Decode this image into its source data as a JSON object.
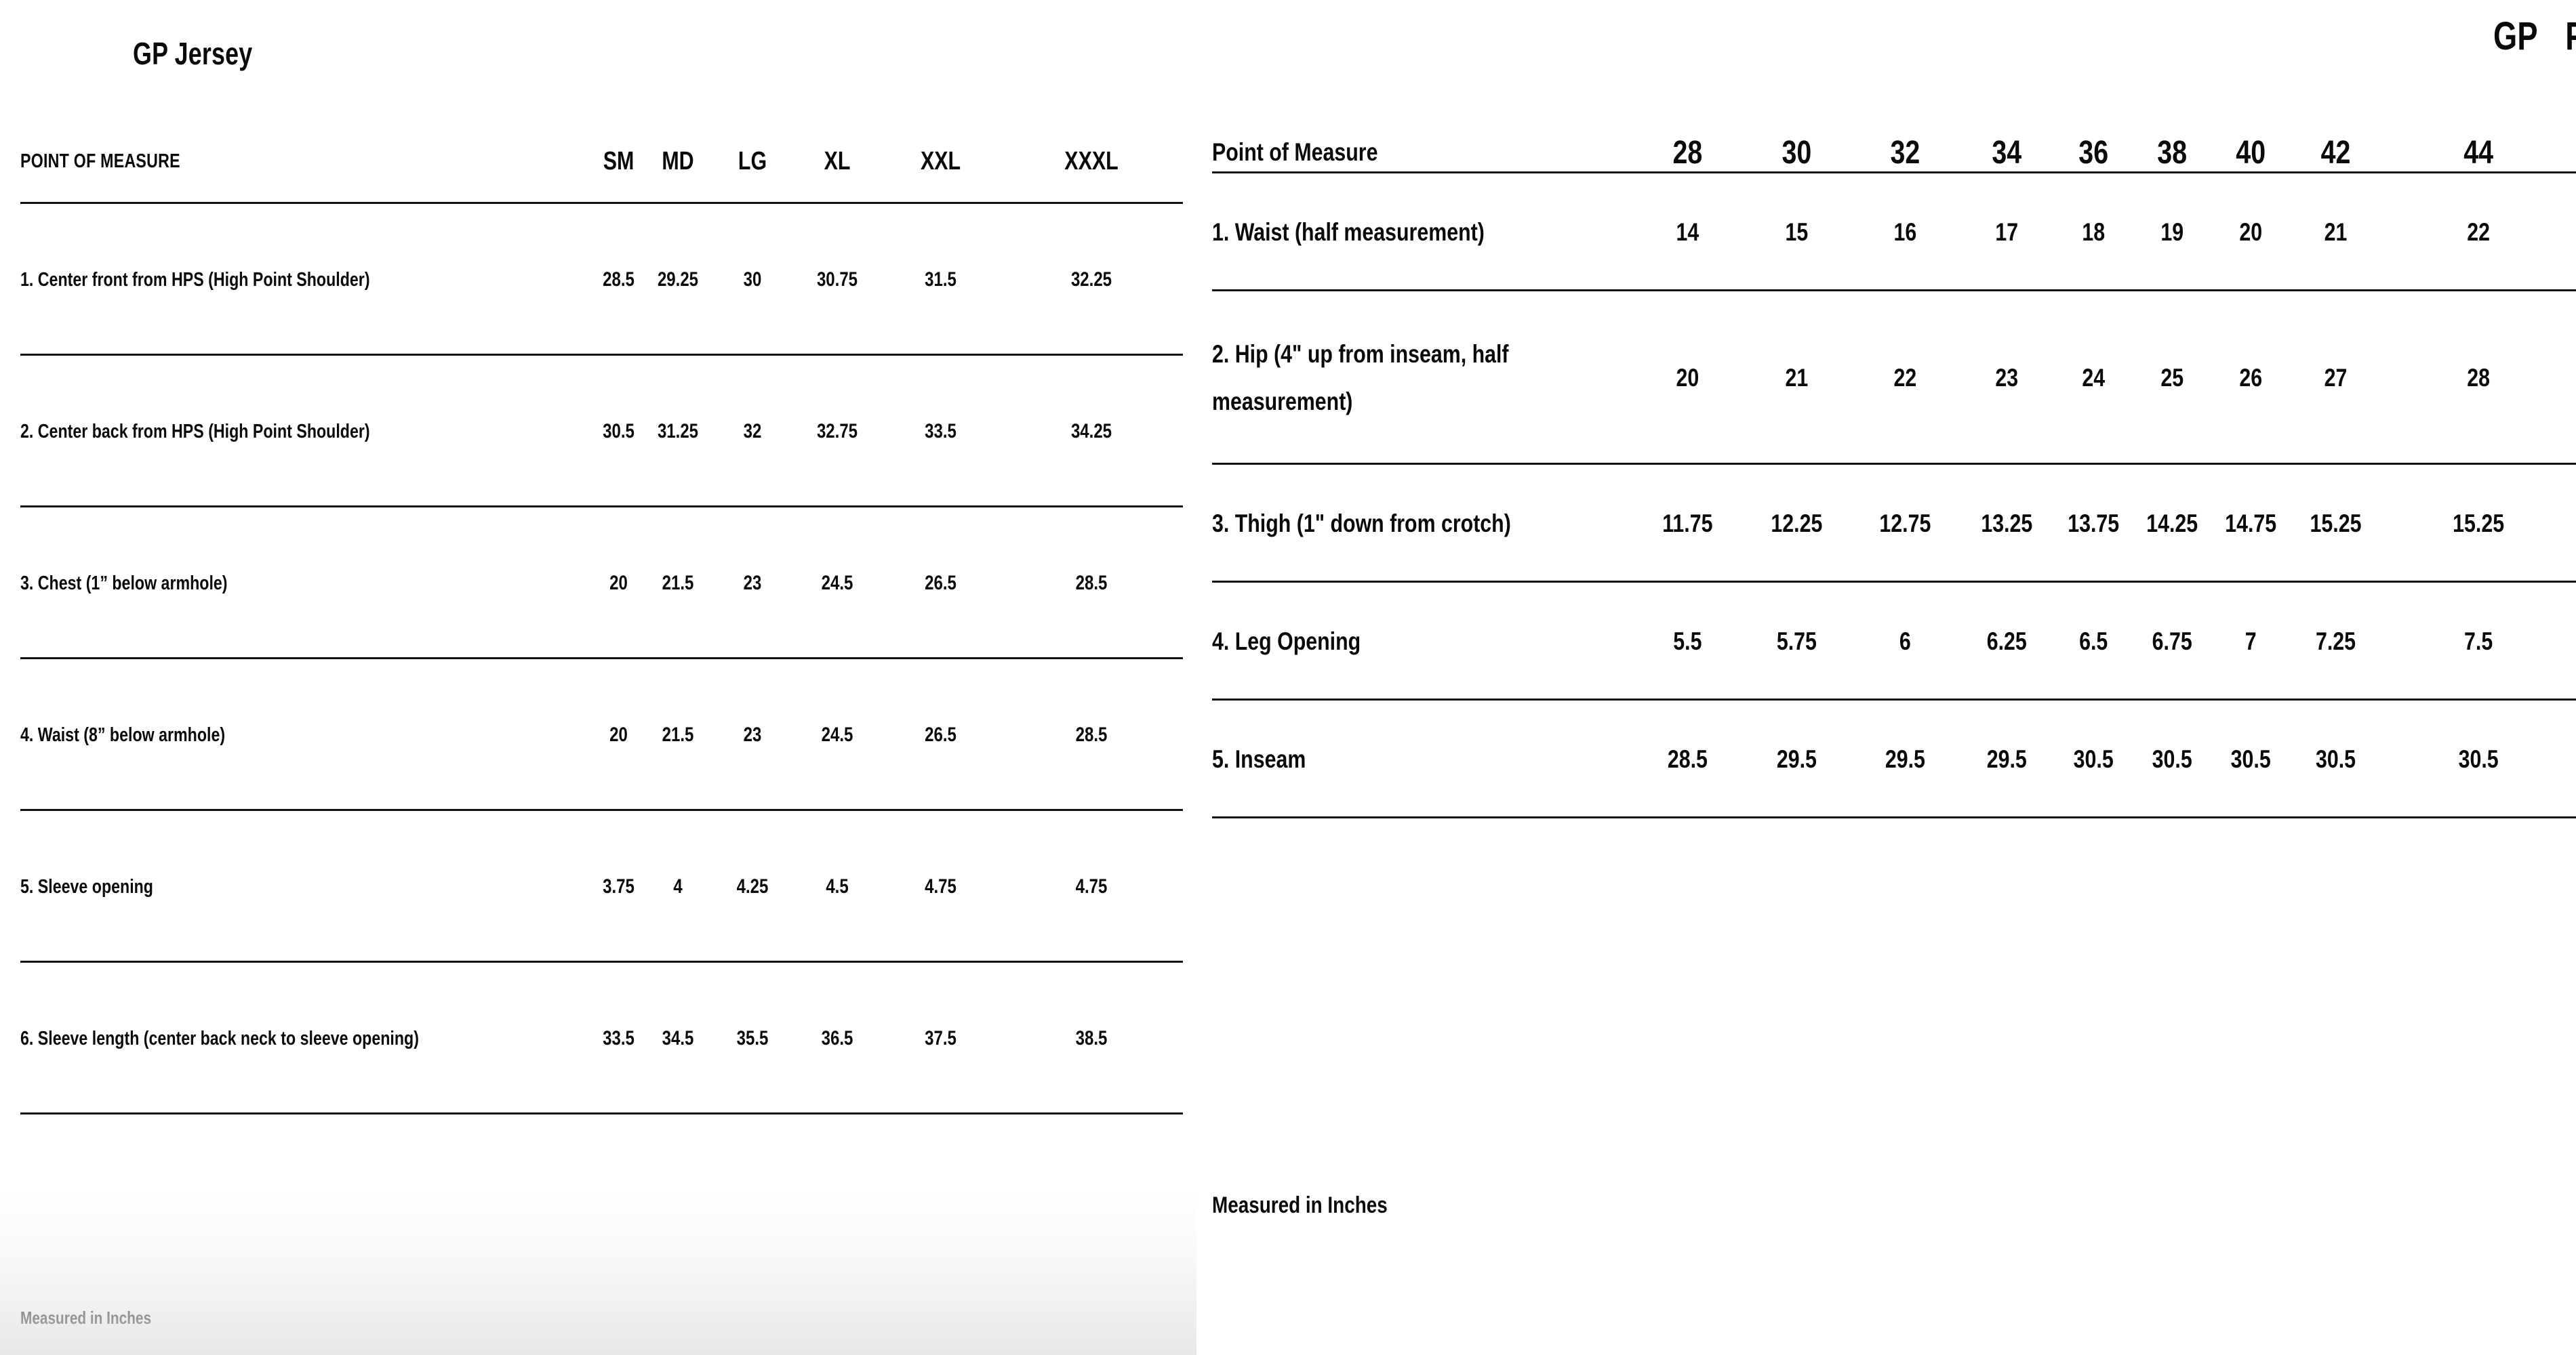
{
  "jersey": {
    "title": "GP Jersey",
    "pom_header": "POINT OF MEASURE",
    "sizes": [
      "SM",
      "MD",
      "LG",
      "XL",
      "XXL",
      "XXXL"
    ],
    "footnote": "Measured in Inches",
    "rows": [
      {
        "label": "1. Center front from HPS (High Point Shoulder)",
        "values": [
          "28.5",
          "29.25",
          "30",
          "30.75",
          "31.5",
          "32.25"
        ]
      },
      {
        "label": "2. Center back from HPS (High Point Shoulder)",
        "values": [
          "30.5",
          "31.25",
          "32",
          "32.75",
          "33.5",
          "34.25"
        ]
      },
      {
        "label": "3. Chest (1” below armhole)",
        "values": [
          "20",
          "21.5",
          "23",
          "24.5",
          "26.5",
          "28.5"
        ]
      },
      {
        "label": "4. Waist (8” below armhole)",
        "values": [
          "20",
          "21.5",
          "23",
          "24.5",
          "26.5",
          "28.5"
        ]
      },
      {
        "label": "5. Sleeve opening",
        "values": [
          "3.75",
          "4",
          "4.25",
          "4.5",
          "4.75",
          "4.75"
        ]
      },
      {
        "label": "6. Sleeve length (center back neck to sleeve opening)",
        "values": [
          "33.5",
          "34.5",
          "35.5",
          "36.5",
          "37.5",
          "38.5"
        ]
      }
    ]
  },
  "pant": {
    "title_brand": "GP",
    "title_item": "Pant",
    "pom_header": "Point of Measure",
    "sizes": [
      "28",
      "30",
      "32",
      "34",
      "36",
      "38",
      "40",
      "42",
      "44"
    ],
    "footnote": "Measured in Inches",
    "rows": [
      {
        "label": "1. Waist (half measurement)",
        "values": [
          "14",
          "15",
          "16",
          "17",
          "18",
          "19",
          "20",
          "21",
          "22"
        ]
      },
      {
        "label": "2. Hip (4\" up from inseam, half measurement)",
        "values": [
          "20",
          "21",
          "22",
          "23",
          "24",
          "25",
          "26",
          "27",
          "28"
        ]
      },
      {
        "label": "3. Thigh (1\" down from crotch)",
        "values": [
          "11.75",
          "12.25",
          "12.75",
          "13.25",
          "13.75",
          "14.25",
          "14.75",
          "15.25",
          "15.25"
        ]
      },
      {
        "label": "4. Leg Opening",
        "values": [
          "5.5",
          "5.75",
          "6",
          "6.25",
          "6.5",
          "6.75",
          "7",
          "7.25",
          "7.5"
        ]
      },
      {
        "label": "5. Inseam",
        "values": [
          "28.5",
          "29.5",
          "29.5",
          "29.5",
          "30.5",
          "30.5",
          "30.5",
          "30.5",
          "30.5"
        ]
      }
    ]
  }
}
